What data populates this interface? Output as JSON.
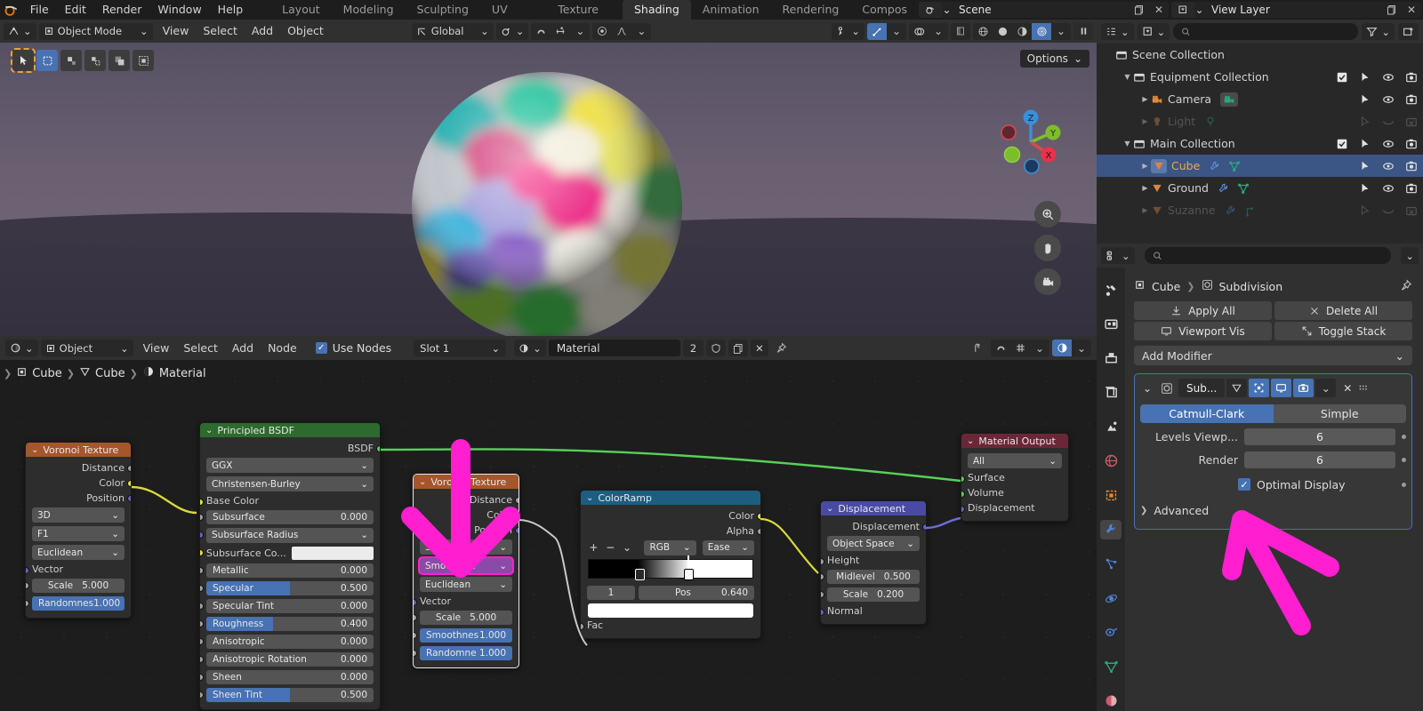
{
  "topbar": {
    "logo_icon": "blender-logo-icon",
    "menus": [
      "File",
      "Edit",
      "Render",
      "Window",
      "Help"
    ],
    "workspace_tabs": [
      "Layout",
      "Modeling",
      "Sculpting",
      "UV Editing",
      "Texture Paint",
      "Shading",
      "Animation",
      "Rendering",
      "Compos"
    ],
    "active_workspace": "Shading",
    "scene_name": "Scene",
    "view_layer_name": "View Layer"
  },
  "viewport": {
    "mode": "Object Mode",
    "menus": [
      "View",
      "Select",
      "Add",
      "Object"
    ],
    "transform_orientation": "Global",
    "options_label": "Options",
    "toolbar_icons": [
      "tweak-select-icon",
      "box-select-icon",
      "cursor-icon",
      "move-icon",
      "rotate-icon",
      "scale-icon"
    ],
    "gizmo_axes": [
      "Z",
      "Y",
      "X"
    ],
    "nav_icons": [
      "zoom-icon",
      "pan-hand-icon",
      "camera-view-icon"
    ],
    "shading_modes": [
      "wireframe-icon",
      "solid-icon",
      "material-preview-icon",
      "rendered-icon"
    ],
    "active_shading": "rendered-icon",
    "pause_icon": "pause-icon"
  },
  "node_editor": {
    "editor_type_icon": "shader-editor-icon",
    "shader_type": "Object",
    "menus": [
      "View",
      "Select",
      "Add",
      "Node"
    ],
    "use_nodes_label": "Use Nodes",
    "use_nodes_checked": true,
    "slot": "Slot 1",
    "material_name": "Material",
    "material_users": "2",
    "breadcrumb": [
      "Cube",
      "Cube",
      "Material"
    ],
    "nodes": [
      {
        "id": "voronoi-1",
        "title": "Voronoi Texture",
        "header_color": "#a5562a",
        "outputs": [
          {
            "label": "Distance",
            "socket": "gray"
          },
          {
            "label": "Color",
            "socket": "yellow"
          },
          {
            "label": "Position",
            "socket": "purple"
          }
        ],
        "dropdowns": [
          "3D",
          "F1",
          "Euclidean"
        ],
        "inputs": [
          {
            "label": "Vector",
            "socket": "purple",
            "type": "label"
          },
          {
            "label": "Scale",
            "value": "5.000",
            "socket": "gray",
            "type": "value"
          },
          {
            "label": "Randomnes",
            "value": "1.000",
            "socket": "gray",
            "type": "slider",
            "fill": 1.0
          }
        ]
      },
      {
        "id": "principled-bsdf",
        "title": "Principled BSDF",
        "header_color": "#2d6a2d",
        "outputs": [
          {
            "label": "BSDF",
            "socket": "green"
          }
        ],
        "dropdowns": [
          "GGX",
          "Christensen-Burley"
        ],
        "inputs": [
          {
            "label": "Base Color",
            "socket": "yellow",
            "type": "label"
          },
          {
            "label": "Subsurface",
            "value": "0.000",
            "socket": "gray",
            "type": "slider",
            "fill": 0
          },
          {
            "label": "Subsurface Radius",
            "socket": "purple",
            "type": "dropdown"
          },
          {
            "label": "Subsurface Co...",
            "socket": "yellow",
            "type": "color",
            "color": "#ececec"
          },
          {
            "label": "Metallic",
            "value": "0.000",
            "socket": "gray",
            "type": "slider",
            "fill": 0
          },
          {
            "label": "Specular",
            "value": "0.500",
            "socket": "gray",
            "type": "slider",
            "fill": 0.5
          },
          {
            "label": "Specular Tint",
            "value": "0.000",
            "socket": "gray",
            "type": "slider",
            "fill": 0
          },
          {
            "label": "Roughness",
            "value": "0.400",
            "socket": "gray",
            "type": "slider",
            "fill": 0.4
          },
          {
            "label": "Anisotropic",
            "value": "0.000",
            "socket": "gray",
            "type": "slider",
            "fill": 0
          },
          {
            "label": "Anisotropic Rotation",
            "value": "0.000",
            "socket": "gray",
            "type": "slider",
            "fill": 0
          },
          {
            "label": "Sheen",
            "value": "0.000",
            "socket": "gray",
            "type": "slider",
            "fill": 0
          },
          {
            "label": "Sheen Tint",
            "value": "0.500",
            "socket": "gray",
            "type": "slider",
            "fill": 0.5
          }
        ]
      },
      {
        "id": "voronoi-2",
        "title": "Voronoi Texture",
        "header_color": "#a5562a",
        "selected": true,
        "outputs": [
          {
            "label": "Distance",
            "socket": "gray"
          },
          {
            "label": "Color",
            "socket": "yellow"
          },
          {
            "label": "Position",
            "socket": "purple"
          }
        ],
        "dropdowns": [
          "3D",
          "Smooth F1",
          "Euclidean"
        ],
        "highlighted_dropdown": "Smooth F1",
        "inputs": [
          {
            "label": "Vector",
            "socket": "purple",
            "type": "label"
          },
          {
            "label": "Scale",
            "value": "5.000",
            "socket": "gray",
            "type": "value"
          },
          {
            "label": "Smoothnes",
            "value": "1.000",
            "socket": "gray",
            "type": "slider",
            "fill": 1.0
          },
          {
            "label": "Randomne",
            "value": "1.000",
            "socket": "gray",
            "type": "slider",
            "fill": 1.0
          }
        ]
      },
      {
        "id": "colorramp",
        "title": "ColorRamp",
        "header_color": "#1d5e80",
        "outputs": [
          {
            "label": "Color",
            "socket": "yellow"
          },
          {
            "label": "Alpha",
            "socket": "gray"
          }
        ],
        "buttons": [
          "+",
          "−",
          "⌄"
        ],
        "color_mode": "RGB",
        "interpolation": "Ease",
        "active_stop_index": "1",
        "pos_label": "Pos",
        "pos_value": "0.640",
        "stop_color": "#ffffff",
        "inputs": [
          {
            "label": "Fac",
            "socket": "gray",
            "type": "label"
          }
        ]
      },
      {
        "id": "displacement",
        "title": "Displacement",
        "header_color": "#4a4aa5",
        "outputs": [
          {
            "label": "Displacement",
            "socket": "purple"
          }
        ],
        "dropdowns": [
          "Object Space"
        ],
        "inputs": [
          {
            "label": "Height",
            "socket": "gray",
            "type": "label"
          },
          {
            "label": "Midlevel",
            "value": "0.500",
            "socket": "gray",
            "type": "value"
          },
          {
            "label": "Scale",
            "value": "0.200",
            "socket": "gray",
            "type": "value"
          },
          {
            "label": "Normal",
            "socket": "purple",
            "type": "label"
          }
        ]
      },
      {
        "id": "material-output",
        "title": "Material Output",
        "header_color": "#6b2737",
        "dropdowns": [
          "All"
        ],
        "inputs": [
          {
            "label": "Surface",
            "socket": "green",
            "type": "label"
          },
          {
            "label": "Volume",
            "socket": "green",
            "type": "label"
          },
          {
            "label": "Displacement",
            "socket": "purple",
            "type": "label"
          }
        ]
      }
    ]
  },
  "outliner": {
    "search_placeholder": "",
    "rows": [
      {
        "name": "Scene Collection",
        "icon": "collection-icon",
        "indent": 0,
        "expand": "",
        "dim": false,
        "selected": false,
        "icons": []
      },
      {
        "name": "Equipment Collection",
        "icon": "collection-icon",
        "indent": 1,
        "expand": "▼",
        "dim": false,
        "selected": false,
        "icons": [
          "checkbox-checked",
          "cursor-icon",
          "eye-icon",
          "camera-icon"
        ]
      },
      {
        "name": "Camera",
        "icon": "camera-data-icon",
        "indent": 2,
        "expand": "▶",
        "dim": false,
        "selected": false,
        "icons": [
          "cursor-icon",
          "eye-icon",
          "camera-icon"
        ]
      },
      {
        "name": "Light",
        "icon": "light-data-icon",
        "indent": 2,
        "expand": "▶",
        "dim": true,
        "selected": false,
        "icons": [
          "cursor-off-icon",
          "eye-closed-icon",
          "camera-off-icon"
        ]
      },
      {
        "name": "Main Collection",
        "icon": "collection-icon",
        "indent": 1,
        "expand": "▼",
        "dim": false,
        "selected": false,
        "icons": [
          "checkbox-checked",
          "cursor-icon",
          "eye-icon",
          "camera-icon"
        ]
      },
      {
        "name": "Cube",
        "icon": "mesh-icon",
        "indent": 2,
        "expand": "▶",
        "dim": false,
        "selected": true,
        "icons": [
          "cursor-icon",
          "eye-icon",
          "camera-icon"
        ]
      },
      {
        "name": "Ground",
        "icon": "mesh-icon",
        "indent": 2,
        "expand": "▶",
        "dim": false,
        "selected": false,
        "icons": [
          "cursor-icon",
          "eye-icon",
          "camera-icon"
        ]
      },
      {
        "name": "Suzanne",
        "icon": "mesh-icon",
        "indent": 2,
        "expand": "▶",
        "dim": true,
        "selected": false,
        "icons": [
          "cursor-off-icon",
          "eye-closed-icon",
          "camera-off-icon"
        ]
      }
    ]
  },
  "properties": {
    "search_placeholder": "",
    "breadcrumb_object": "Cube",
    "breadcrumb_modifier": "Subdivision",
    "buttons": [
      {
        "label": "Apply All",
        "icon": "download-icon"
      },
      {
        "label": "Delete All",
        "icon": "x-icon"
      },
      {
        "label": "Viewport Vis",
        "icon": "monitor-icon"
      },
      {
        "label": "Toggle Stack",
        "icon": "expand-icon"
      }
    ],
    "add_modifier_label": "Add Modifier",
    "modifier": {
      "name": "Sub...",
      "type_segments": [
        "Catmull-Clark",
        "Simple"
      ],
      "active_segment": "Catmull-Clark",
      "levels_viewport_label": "Levels Viewp...",
      "levels_viewport_value": "6",
      "render_label": "Render",
      "render_value": "6",
      "optimal_display_label": "Optimal Display",
      "optimal_display_checked": true,
      "advanced_label": "Advanced",
      "header_toggles": [
        "edit-mode-on-icon",
        "on-cage-icon",
        "realtime-icon",
        "render-icon"
      ]
    },
    "tabs": [
      "tool-icon",
      "render-icon",
      "output-icon",
      "viewlayer-icon",
      "scene-icon",
      "world-icon",
      "object-icon",
      "modifier-icon",
      "particles-icon",
      "physics-icon",
      "constraint-icon",
      "data-icon",
      "material-icon"
    ],
    "active_tab": "modifier-icon"
  },
  "annotations": {
    "arrow_color": "#ff1fd0",
    "arrows": [
      "down-arrow-on-smooth-f1",
      "up-arrow-on-optimal-display"
    ]
  }
}
